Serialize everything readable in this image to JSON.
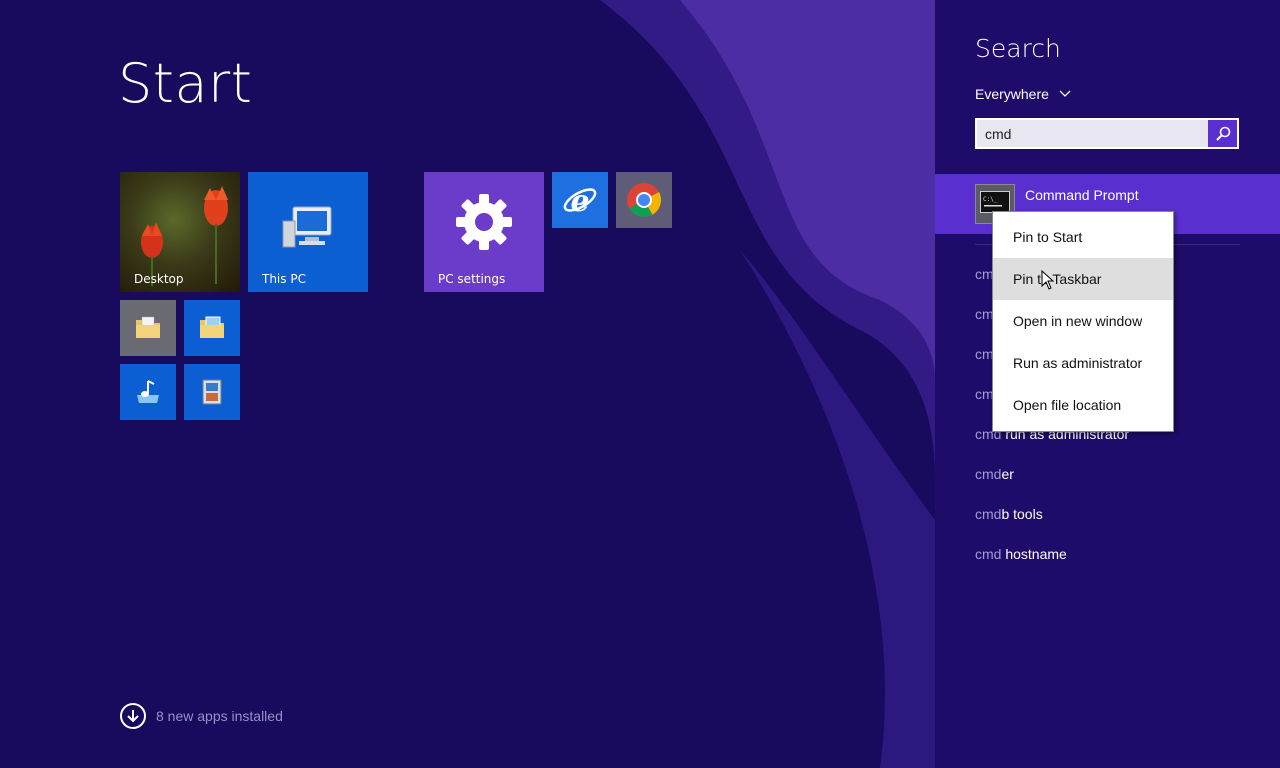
{
  "start": {
    "title": "Start"
  },
  "tiles": {
    "desktop": "Desktop",
    "this_pc": "This PC",
    "pc_settings": "PC settings"
  },
  "footer": {
    "new_apps": "8 new apps installed"
  },
  "search": {
    "title": "Search",
    "scope": "Everywhere",
    "query": "cmd",
    "top_result": "Command Prompt",
    "suggestions": [
      {
        "q": "cmd",
        "rest": ""
      },
      {
        "q": "cmd",
        "rest": ""
      },
      {
        "q": "cmd",
        "rest": ""
      },
      {
        "q": "cmd",
        "rest": ""
      },
      {
        "q": "cmd",
        "rest": " run as administrator"
      },
      {
        "q": "cmd",
        "rest": "er"
      },
      {
        "q": "cmd",
        "rest": "b tools"
      },
      {
        "q": "cmd",
        "rest": " hostname"
      }
    ]
  },
  "context_menu": {
    "items": [
      "Pin to Start",
      "Pin to Taskbar",
      "Open in new window",
      "Run as administrator",
      "Open file location"
    ],
    "highlighted": "Pin to Taskbar"
  },
  "colors": {
    "background": "#180a5c",
    "search_pane": "#1e0b6a",
    "accent": "#5a2fd0",
    "tile_blue": "#0b5fd3",
    "tile_purple": "#6b3bc9"
  }
}
